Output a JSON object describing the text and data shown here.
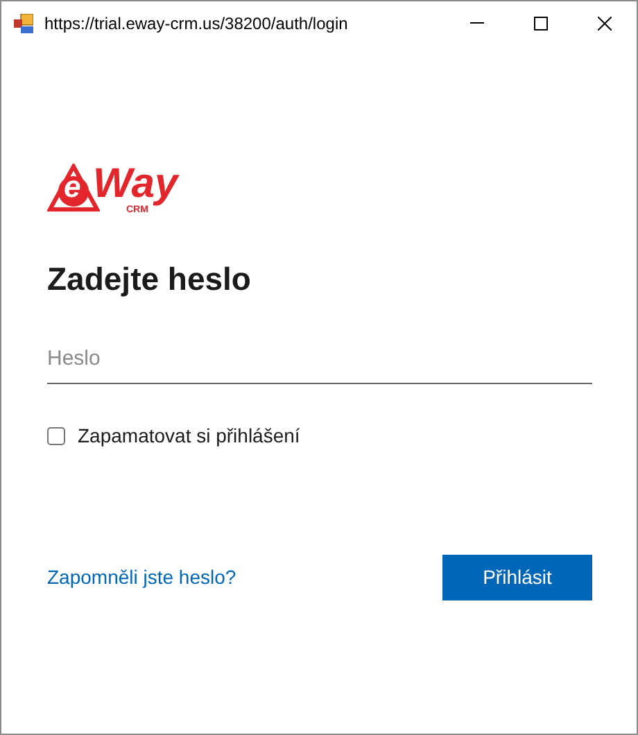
{
  "window": {
    "title": "https://trial.eway-crm.us/38200/auth/login"
  },
  "logo": {
    "mark": "e",
    "word": "Way",
    "sub": "CRM"
  },
  "heading": "Zadejte heslo",
  "password": {
    "placeholder": "Heslo"
  },
  "remember": {
    "label": "Zapamatovat si přihlášení",
    "checked": false
  },
  "forgot_link": "Zapomněli jste heslo?",
  "submit": "Přihlásit"
}
